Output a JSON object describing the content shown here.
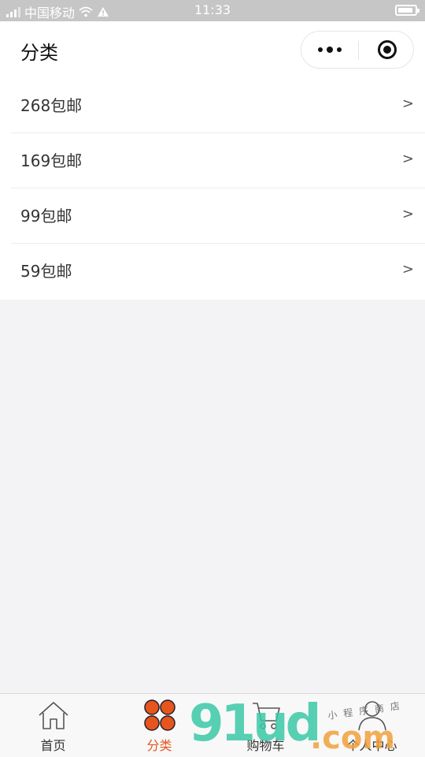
{
  "status_bar": {
    "carrier": "中国移动",
    "time": "11:33",
    "battery_level": 0.9
  },
  "nav_bar": {
    "title": "分类"
  },
  "categories": [
    {
      "label": "268包邮",
      "arrow": ">"
    },
    {
      "label": "169包邮",
      "arrow": ">"
    },
    {
      "label": "99包邮",
      "arrow": ">"
    },
    {
      "label": "59包邮",
      "arrow": ">"
    }
  ],
  "tab_bar": {
    "tabs": [
      {
        "label": "首页",
        "icon": "home-icon",
        "active": false
      },
      {
        "label": "分类",
        "icon": "category-icon",
        "active": true
      },
      {
        "label": "购物车",
        "icon": "cart-icon",
        "active": false
      },
      {
        "label": "个人中心",
        "icon": "user-icon",
        "active": false
      }
    ]
  },
  "watermark": {
    "main": "91ud",
    "suffix": ".com",
    "tagline": "小程序商店"
  },
  "colors": {
    "accent": "#e8541e",
    "background": "#f3f2f5",
    "statusbar": "#c6c6c6"
  }
}
